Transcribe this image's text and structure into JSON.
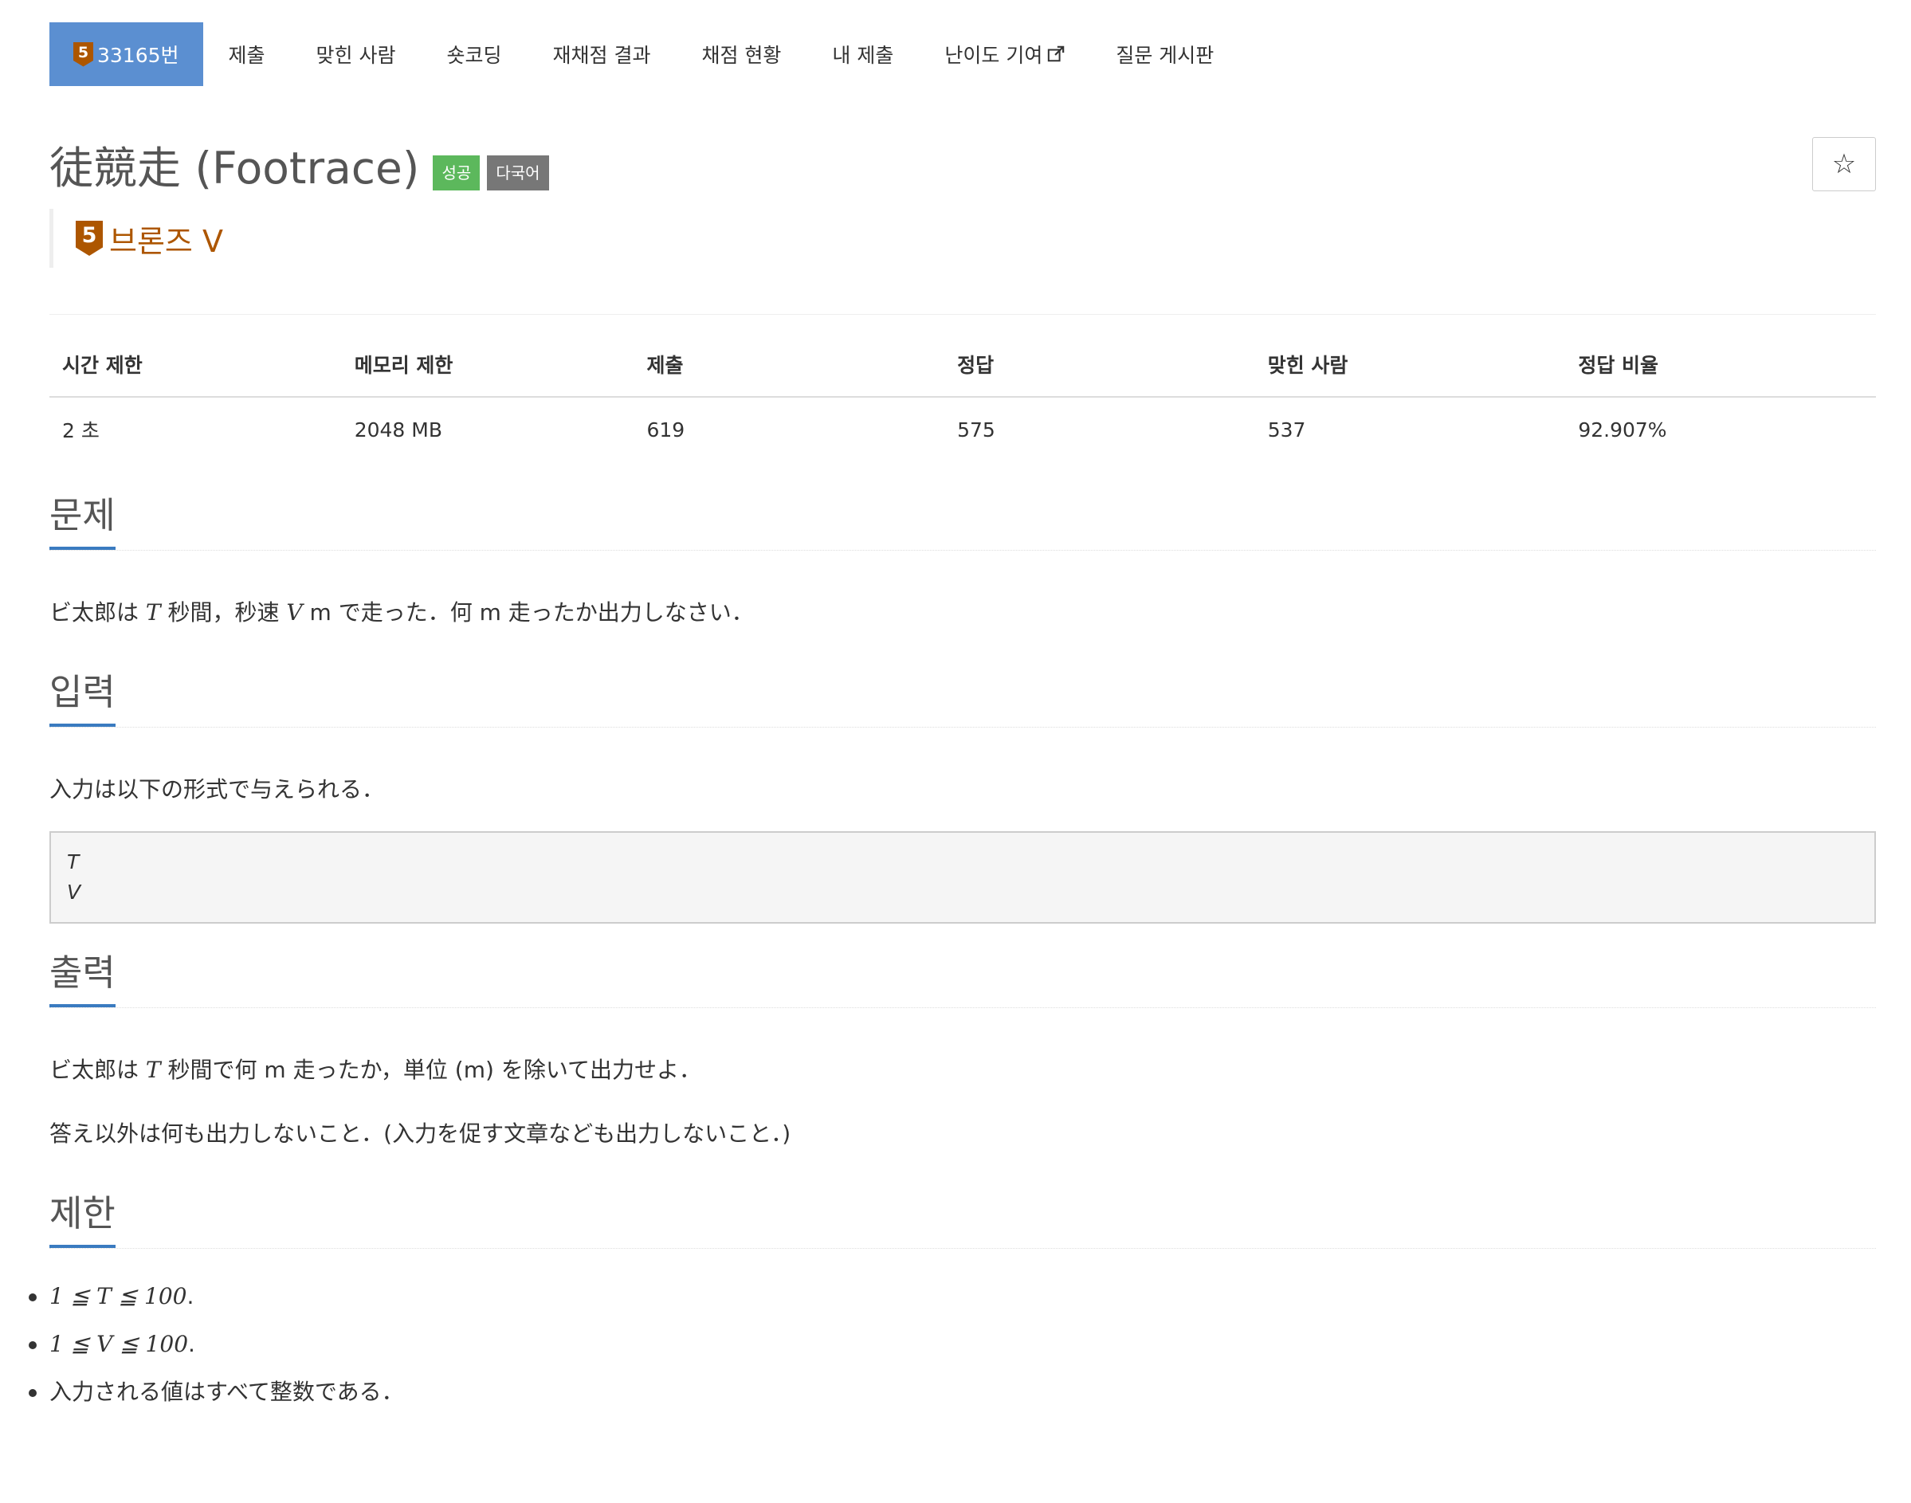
{
  "nav": {
    "tier_badge": "5",
    "problem_id": "33165번",
    "items": [
      "제출",
      "맞힌 사람",
      "숏코딩",
      "재채점 결과",
      "채점 현황",
      "내 제출"
    ],
    "difficulty_contrib": "난이도 기여",
    "qna": "질문 게시판"
  },
  "title": "徒競走 (Footrace)",
  "labels": {
    "success": "성공",
    "multilang": "다국어"
  },
  "star_icon": "☆",
  "tier": {
    "badge": "5",
    "name": "브론즈 V",
    "color": "#ad5600"
  },
  "info_table": {
    "headers": [
      "시간 제한",
      "메모리 제한",
      "제출",
      "정답",
      "맞힌 사람",
      "정답 비율"
    ],
    "values": [
      "2 초",
      "2048 MB",
      "619",
      "575",
      "537",
      "92.907%"
    ]
  },
  "sections": {
    "problem": {
      "heading": "문제",
      "text_1": "ビ太郎は ",
      "var_t": "T",
      "text_2": " 秒間，秒速 ",
      "var_v": "V",
      "text_3": " m で走った．何 m 走ったか出力しなさい．"
    },
    "input": {
      "heading": "입력",
      "text": "入力は以下の形式で与えられる．",
      "format": [
        "T",
        "V"
      ]
    },
    "output": {
      "heading": "출력",
      "text_1a": "ビ太郎は ",
      "var_t": "T",
      "text_1b": " 秒間で何 m 走ったか，単位 (m) を除いて出力せよ．",
      "text_2": "答え以外は何も出力しないこと．(入力を促す文章なども出力しないこと．)"
    },
    "limits": {
      "heading": "제한",
      "item_1": "1 ≦ T ≦ 100",
      "item_2": "1 ≦ V ≦ 100",
      "item_3": "入力される値はすべて整数である．",
      "period": "."
    }
  },
  "colors": {
    "nav_active": "#5b8fd1",
    "accent": "#3a7bc0",
    "success": "#5cb85c",
    "multilang": "#777777"
  }
}
